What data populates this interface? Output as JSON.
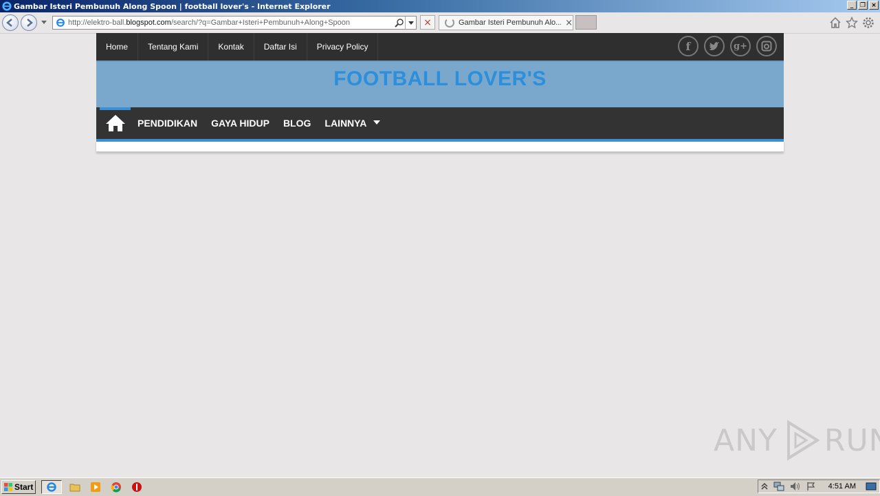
{
  "window": {
    "title": "Gambar Isteri Pembunuh Along Spoon | football lover's - Internet Explorer",
    "controls": [
      "_",
      "❐",
      "×"
    ]
  },
  "browser": {
    "url_prefix": "http://elektro-ball.",
    "url_domain": "blogspot.com",
    "url_suffix": "/search/?q=Gambar+Isteri+Pembunuh+Along+Spoon",
    "tab_title": "Gambar Isteri Pembunuh Alo...",
    "tab_close": "×",
    "stop": "×"
  },
  "site": {
    "top_menu": [
      {
        "label": "Home"
      },
      {
        "label": "Tentang Kami"
      },
      {
        "label": "Kontak"
      },
      {
        "label": "Daftar Isi"
      },
      {
        "label": "Privacy Policy"
      }
    ],
    "social": [
      {
        "icon": "facebook-icon",
        "glyph": "f"
      },
      {
        "icon": "twitter-icon",
        "glyph": "t"
      },
      {
        "icon": "google-plus-icon",
        "glyph": "g+"
      },
      {
        "icon": "instagram-icon",
        "glyph": "◎"
      }
    ],
    "title": "FOOTBALL LOVER'S",
    "main_menu": [
      {
        "label": "PENDIDIKAN"
      },
      {
        "label": "GAYA HIDUP"
      },
      {
        "label": "BLOG"
      },
      {
        "label": "LAINNYA"
      }
    ],
    "colors": {
      "accent": "#3b8fd6",
      "header_bg": "#7aa7cc",
      "title": "#2b8fdc",
      "menu_bg": "#333333"
    }
  },
  "watermark": {
    "left": "ANY",
    "right": "RUN"
  },
  "taskbar": {
    "start_label": "Start",
    "clock": "4:51 AM"
  }
}
